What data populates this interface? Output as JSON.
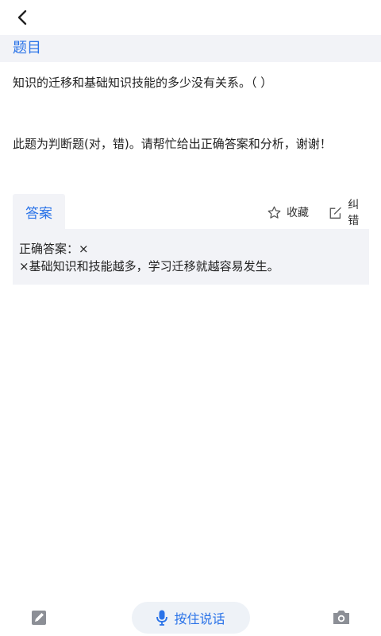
{
  "header": {
    "back_icon": "chevron-left-icon"
  },
  "section": {
    "title": "题目"
  },
  "question": {
    "text": "知识的迁移和基础知识技能的多少没有关系。（  ）",
    "note": "此题为判断题(对，错)。请帮忙给出正确答案和分析，谢谢！"
  },
  "answer": {
    "tab_label": "答案",
    "favorite_label": "收藏",
    "favorite_icon": "star-outline-icon",
    "correct_label": "纠错",
    "correct_icon": "edit-icon",
    "line1": "正确答案：×",
    "line2": "×基础知识和技能越多，学习迁移就越容易发生。"
  },
  "bottom": {
    "left_icon": "pencil-note-icon",
    "voice_label": "按住说话",
    "voice_icon": "microphone-icon",
    "right_icon": "camera-icon"
  },
  "colors": {
    "accent": "#2a73e8",
    "panel_bg": "#f2f3f7"
  }
}
